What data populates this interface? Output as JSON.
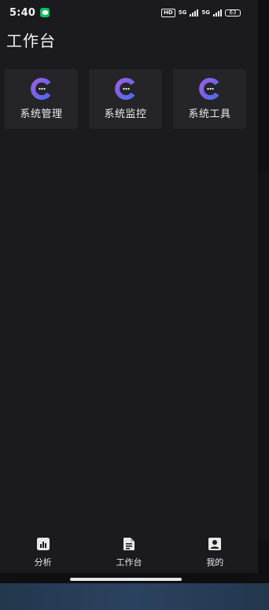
{
  "status_bar": {
    "time": "5:40",
    "hd_badge": "HD",
    "sim1": "5G",
    "sim2": "5G",
    "battery": "63"
  },
  "page": {
    "title": "工作台"
  },
  "tiles": [
    {
      "label": "系统管理",
      "icon": "system-management-icon"
    },
    {
      "label": "系统监控",
      "icon": "system-monitor-icon"
    },
    {
      "label": "系统工具",
      "icon": "system-tools-icon"
    }
  ],
  "bottom_nav": {
    "items": [
      {
        "label": "分析",
        "icon": "chart-icon"
      },
      {
        "label": "工作台",
        "icon": "document-icon"
      },
      {
        "label": "我的",
        "icon": "profile-icon"
      }
    ]
  },
  "colors": {
    "background": "#1b1a1f",
    "tile_background": "#252428",
    "icon_gradient_start": "#9b5de5",
    "icon_gradient_end": "#4f6bed",
    "text": "#f2f2f2"
  }
}
